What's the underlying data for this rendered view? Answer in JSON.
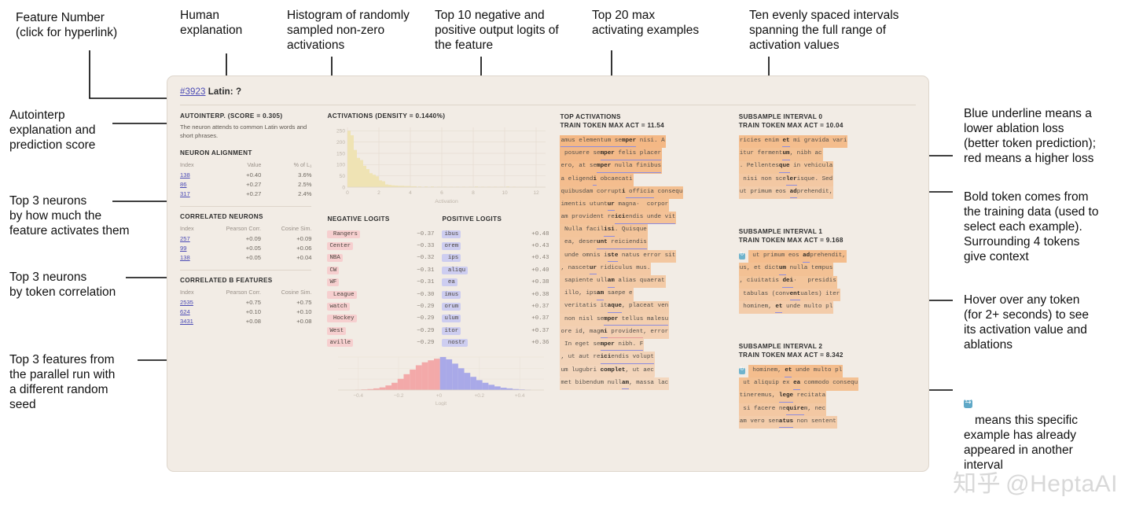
{
  "annotations": {
    "feature_number": "Feature Number\n(click for hyperlink)",
    "human_explanation": "Human\nexplanation",
    "histogram": "Histogram of randomly\nsampled non-zero\nactivations",
    "logits": "Top 10 negative and\npositive output logits of\nthe feature",
    "top_activations": "Top 20 max\nactivating examples",
    "intervals": "Ten evenly spaced intervals\nspanning the full range of\nactivation values",
    "autointerp": "Autointerp\nexplanation and\nprediction score",
    "neuron_alignment": "Top 3 neurons\nby how much the\nfeature activates them",
    "correlated_neurons": "Top 3 neurons\nby token correlation",
    "correlated_features": "Top 3 features from\nthe parallel run with\na different random\nseed",
    "underline": "Blue underline means a\nlower ablation loss\n(better token prediction);\nred means a higher loss",
    "bold_token": "Bold token comes from\nthe training data (used to\nselect each example).\nSurrounding 4 tokens\ngive context",
    "hover": "Hover over any token\n(for 2+ seconds) to see\nits activation value and\nablations",
    "dupe_legend": "means this specific\nexample has already\nappeared in another\ninterval"
  },
  "watermark": "@HeptaAI",
  "card": {
    "feature_id": "#3923",
    "feature_title": "Latin: ?",
    "autointerp": {
      "title": "AUTOINTERP. (SCORE = 0.305)",
      "text": "The neuron attends to common Latin words and short phrases."
    },
    "neuron_alignment": {
      "title": "NEURON ALIGNMENT",
      "columns": [
        "Index",
        "Value",
        "% of L₁"
      ],
      "rows": [
        {
          "index": "138",
          "value": "+0.40",
          "pct": "3.6%"
        },
        {
          "index": "86",
          "value": "+0.27",
          "pct": "2.5%"
        },
        {
          "index": "317",
          "value": "+0.27",
          "pct": "2.4%"
        }
      ]
    },
    "correlated_neurons": {
      "title": "CORRELATED NEURONS",
      "columns": [
        "Index",
        "Pearson Corr.",
        "Cosine Sim."
      ],
      "rows": [
        {
          "index": "257",
          "pearson": "+0.09",
          "cosine": "+0.09"
        },
        {
          "index": "99",
          "pearson": "+0.05",
          "cosine": "+0.06"
        },
        {
          "index": "138",
          "pearson": "+0.05",
          "cosine": "+0.04"
        }
      ]
    },
    "correlated_b_features": {
      "title": "CORRELATED B FEATURES",
      "columns": [
        "Index",
        "Pearson Corr.",
        "Cosine Sim."
      ],
      "rows": [
        {
          "index": "2535",
          "pearson": "+0.75",
          "cosine": "+0.75"
        },
        {
          "index": "624",
          "pearson": "+0.10",
          "cosine": "+0.10"
        },
        {
          "index": "3431",
          "pearson": "+0.08",
          "cosine": "+0.08"
        }
      ]
    },
    "activations_title": "ACTIVATIONS (DENSITY = 0.1440%)",
    "negative_logits_title": "NEGATIVE LOGITS",
    "positive_logits_title": "POSITIVE LOGITS",
    "negative_logits": [
      {
        "token": " Rangers",
        "value": "−0.37"
      },
      {
        "token": "Center",
        "value": "−0.33"
      },
      {
        "token": "NBA",
        "value": "−0.32"
      },
      {
        "token": "CW",
        "value": "−0.31"
      },
      {
        "token": "WF",
        "value": "−0.31"
      },
      {
        "token": " League",
        "value": "−0.30"
      },
      {
        "token": "watch",
        "value": "−0.29"
      },
      {
        "token": " Hockey",
        "value": "−0.29"
      },
      {
        "token": "West",
        "value": "−0.29"
      },
      {
        "token": "aville",
        "value": "−0.29"
      }
    ],
    "positive_logits": [
      {
        "token": "ibus",
        "value": "+0.48"
      },
      {
        "token": "orem",
        "value": "+0.43"
      },
      {
        "token": " ips",
        "value": "+0.43"
      },
      {
        "token": " aliqu",
        "value": "+0.40"
      },
      {
        "token": " ea",
        "value": "+0.38"
      },
      {
        "token": "imus",
        "value": "+0.38"
      },
      {
        "token": "orum",
        "value": "+0.37"
      },
      {
        "token": "ulum",
        "value": "+0.37"
      },
      {
        "token": "itor",
        "value": "+0.37"
      },
      {
        "token": " nostr",
        "value": "+0.36"
      }
    ],
    "top_activations": {
      "title": "TOP ACTIVATIONS",
      "subtitle": "TRAIN TOKEN MAX ACT = 11.54",
      "rows": [
        [
          {
            "t": "amus elementum se",
            "u": "b"
          },
          {
            "t": "mper",
            "b": true,
            "u": "b"
          },
          {
            "t": " nisi. A"
          }
        ],
        [
          {
            "t": " posuere se"
          },
          {
            "t": "mper",
            "b": true,
            "u": "b"
          },
          {
            "t": " felis placer",
            "u": "b"
          }
        ],
        [
          {
            "t": "ero, at se"
          },
          {
            "t": "mper",
            "b": true,
            "u": "b"
          },
          {
            "t": " nulla finibus",
            "u": "b"
          }
        ],
        [
          {
            "t": "a eligend"
          },
          {
            "t": "i",
            "b": true,
            "u": "b"
          },
          {
            "t": " obcaecati"
          }
        ],
        [
          {
            "t": "quibusdam corrupt"
          },
          {
            "t": "i",
            "b": true
          },
          {
            "t": " officia",
            "u": "b"
          },
          {
            "t": " consequ"
          }
        ],
        [
          {
            "t": "imentis utunt"
          },
          {
            "t": "ur",
            "b": true,
            "u": "b"
          },
          {
            "t": " magna·  corpor"
          }
        ],
        [
          {
            "t": "am provident re"
          },
          {
            "t": "ici",
            "b": true,
            "u": "b"
          },
          {
            "t": "endis unde vit",
            "u": "b"
          }
        ],
        [
          {
            "t": " Nulla facil"
          },
          {
            "t": "isi",
            "b": true,
            "u": "b"
          },
          {
            "t": ". Quisque"
          }
        ],
        [
          {
            "t": " ea, deser"
          },
          {
            "t": "unt",
            "b": true,
            "u": "b"
          },
          {
            "t": " reiciendis",
            "u": "b"
          }
        ],
        [
          {
            "t": " unde omnis i"
          },
          {
            "t": "ste",
            "b": true,
            "u": "b"
          },
          {
            "t": " natus error sit"
          }
        ],
        [
          {
            "t": ", nascet"
          },
          {
            "t": "ur",
            "b": true,
            "u": "b"
          },
          {
            "t": " ridiculus mus."
          }
        ],
        [
          {
            "t": " sapiente ull"
          },
          {
            "t": "am",
            "b": true,
            "u": "b"
          },
          {
            "t": " alias quaerat"
          }
        ],
        [
          {
            "t": " illo, ips"
          },
          {
            "t": "am",
            "b": true,
            "u": "b"
          },
          {
            "t": " saepe e"
          }
        ],
        [
          {
            "t": " veritatis it"
          },
          {
            "t": "aque",
            "b": true,
            "u": "b"
          },
          {
            "t": ", placeat ven"
          }
        ],
        [
          {
            "t": " non nisl se"
          },
          {
            "t": "mper",
            "b": true,
            "u": "b"
          },
          {
            "t": " tellus malesu",
            "u": "b"
          }
        ],
        [
          {
            "t": "ore id, mag"
          },
          {
            "t": "ni",
            "b": true,
            "u": "b"
          },
          {
            "t": " provident",
            "u": "r"
          },
          {
            "t": ", error"
          }
        ],
        [
          {
            "t": " In eget se"
          },
          {
            "t": "mper",
            "b": true,
            "u": "b"
          },
          {
            "t": " nibh. F",
            "u": "b"
          }
        ],
        [
          {
            "t": ", ut aut re"
          },
          {
            "t": "ici",
            "b": true,
            "u": "b"
          },
          {
            "t": "endis volupt",
            "u": "b"
          }
        ],
        [
          {
            "t": "um lugubri "
          },
          {
            "t": "complet",
            "b": true
          },
          {
            "t": ", ut aec"
          }
        ],
        [
          {
            "t": "met bibendum null"
          },
          {
            "t": "am",
            "b": true,
            "u": "b"
          },
          {
            "t": ", massa lac"
          }
        ]
      ]
    },
    "intervals": [
      {
        "title": "SUBSAMPLE INTERVAL 0",
        "subtitle": "TRAIN TOKEN MAX ACT = 10.04",
        "rows": [
          {
            "dupe": false,
            "tokens": [
              {
                "t": "ricies enim "
              },
              {
                "t": "et",
                "b": true,
                "u": "b"
              },
              {
                "t": " mi gravida vari"
              }
            ]
          },
          {
            "dupe": false,
            "tokens": [
              {
                "t": "itur ferment"
              },
              {
                "t": "um",
                "b": true,
                "u": "b"
              },
              {
                "t": ", nibh ac"
              }
            ]
          },
          {
            "dupe": false,
            "tokens": [
              {
                "t": ". Pellentes"
              },
              {
                "t": "que",
                "b": true,
                "u": "b"
              },
              {
                "t": " in vehicula"
              }
            ]
          },
          {
            "dupe": false,
            "tokens": [
              {
                "t": " nisi non sce"
              },
              {
                "t": "ler",
                "b": true,
                "u": "b"
              },
              {
                "t": "isque. Sed"
              }
            ]
          },
          {
            "dupe": false,
            "tokens": [
              {
                "t": "ut primum eos "
              },
              {
                "t": "ad",
                "b": true,
                "u": "b"
              },
              {
                "t": "prehendit,"
              }
            ]
          }
        ]
      },
      {
        "title": "SUBSAMPLE INTERVAL 1",
        "subtitle": "TRAIN TOKEN MAX ACT = 9.168",
        "rows": [
          {
            "dupe": true,
            "tokens": [
              {
                "t": " ut primum eos "
              },
              {
                "t": "ad",
                "b": true,
                "u": "b"
              },
              {
                "t": "prehendit,"
              }
            ]
          },
          {
            "dupe": false,
            "tokens": [
              {
                "t": "us, et dict"
              },
              {
                "t": "um",
                "b": true,
                "u": "b"
              },
              {
                "t": " nulla tempus"
              }
            ]
          },
          {
            "dupe": false,
            "tokens": [
              {
                "t": ", ciuitatis "
              },
              {
                "t": "dei",
                "b": true,
                "u": "b"
              },
              {
                "t": "·   presidis"
              }
            ]
          },
          {
            "dupe": false,
            "tokens": [
              {
                "t": " tabulas (conv"
              },
              {
                "t": "ent",
                "b": true,
                "u": "b"
              },
              {
                "t": "uales) iter"
              }
            ]
          },
          {
            "dupe": false,
            "tokens": [
              {
                "t": " hominem, "
              },
              {
                "t": "et",
                "b": true,
                "u": "b"
              },
              {
                "t": " unde multo pl"
              }
            ]
          }
        ]
      },
      {
        "title": "SUBSAMPLE INTERVAL 2",
        "subtitle": "TRAIN TOKEN MAX ACT = 8.342",
        "rows": [
          {
            "dupe": true,
            "tokens": [
              {
                "t": " hominem, "
              },
              {
                "t": "et",
                "b": true,
                "u": "b"
              },
              {
                "t": " unde multo pl"
              }
            ]
          },
          {
            "dupe": false,
            "tokens": [
              {
                "t": " ut aliquip ex "
              },
              {
                "t": "ea",
                "b": true,
                "u": "b"
              },
              {
                "t": " commodo consequ"
              }
            ]
          },
          {
            "dupe": false,
            "tokens": [
              {
                "t": "tineremus, "
              },
              {
                "t": "lege",
                "b": true,
                "u": "b"
              },
              {
                "t": " recitata"
              }
            ]
          },
          {
            "dupe": false,
            "tokens": [
              {
                "t": " si facere ne"
              },
              {
                "t": "quire",
                "b": true,
                "u": "b"
              },
              {
                "t": "m, nec"
              }
            ]
          },
          {
            "dupe": false,
            "tokens": [
              {
                "t": "am vero sen"
              },
              {
                "t": "atus",
                "b": true,
                "u": "b"
              },
              {
                "t": " non sentent"
              }
            ]
          }
        ]
      }
    ]
  },
  "chart_data": [
    {
      "type": "bar",
      "title": "ACTIVATIONS (DENSITY = 0.1440%)",
      "xlabel": "Activation",
      "ylabel": "",
      "xlim": [
        0,
        12.6
      ],
      "ylim": [
        0,
        265
      ],
      "xticks": [
        "0",
        "2",
        "4",
        "6",
        "8",
        "10",
        "12"
      ],
      "yticks": [
        "0",
        "50",
        "100",
        "150",
        "200",
        "250"
      ],
      "color": "#efe3b4",
      "grid": true,
      "bin_centers": [
        0.1,
        0.3,
        0.5,
        0.7,
        0.9,
        1.1,
        1.3,
        1.5,
        1.7,
        1.9,
        2.1,
        2.3,
        2.5,
        2.7,
        2.9,
        3.1,
        3.3,
        3.5,
        3.7,
        3.9,
        4.1,
        4.3,
        4.6,
        5.0,
        5.4,
        5.8,
        6.2,
        6.6,
        7.0,
        7.4,
        7.8,
        8.2,
        8.6,
        9.0,
        9.4,
        9.8,
        10.2,
        10.6,
        11.0,
        11.4
      ],
      "values": [
        250,
        230,
        165,
        130,
        120,
        95,
        80,
        62,
        55,
        48,
        30,
        26,
        12,
        10,
        8,
        7,
        6,
        6,
        5,
        5,
        4,
        4,
        3,
        3,
        3,
        2,
        2,
        2,
        2,
        2,
        2,
        3,
        2,
        2,
        2,
        2,
        3,
        2,
        1,
        1
      ]
    },
    {
      "type": "bar",
      "title": "Logit distribution",
      "xlabel": "Logit",
      "ylabel": "",
      "xlim": [
        -0.5,
        0.52
      ],
      "xticks": [
        "−0.4",
        "−0.2",
        "+0",
        "+0.2",
        "+0.4"
      ],
      "negative_color": "#f3a9a9",
      "positive_color": "#a9a9e8",
      "grid": true,
      "bin_centers": [
        -0.4,
        -0.37,
        -0.34,
        -0.31,
        -0.28,
        -0.25,
        -0.22,
        -0.19,
        -0.16,
        -0.13,
        -0.1,
        -0.07,
        -0.04,
        -0.01,
        0.02,
        0.05,
        0.08,
        0.11,
        0.14,
        0.17,
        0.2,
        0.23,
        0.26,
        0.29,
        0.32,
        0.35,
        0.38,
        0.41,
        0.44
      ],
      "values": [
        1,
        2,
        3,
        5,
        8,
        14,
        22,
        34,
        48,
        62,
        75,
        84,
        90,
        95,
        100,
        93,
        80,
        66,
        52,
        40,
        30,
        22,
        16,
        11,
        7,
        5,
        3,
        2,
        1
      ]
    }
  ]
}
